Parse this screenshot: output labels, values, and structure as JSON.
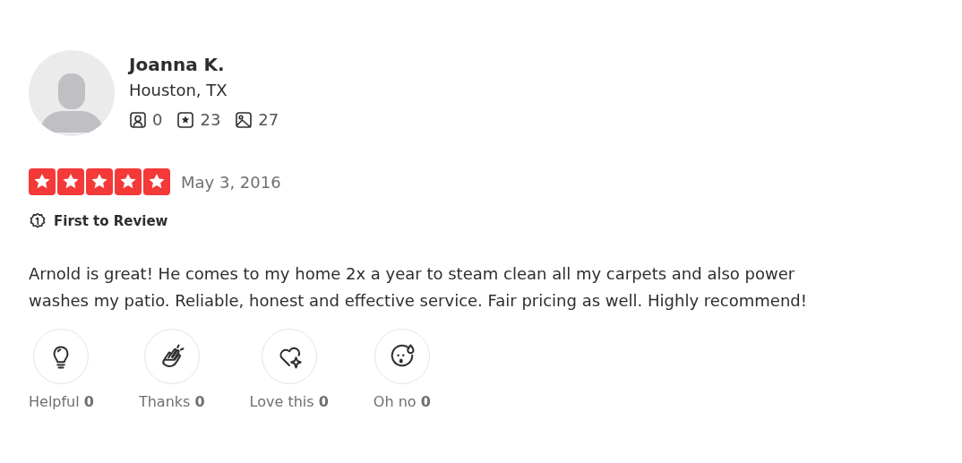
{
  "reviewer": {
    "name": "Joanna K.",
    "location": "Houston, TX",
    "stats": [
      {
        "kind": "friends",
        "count": "0"
      },
      {
        "kind": "reviews",
        "count": "23"
      },
      {
        "kind": "photos",
        "count": "27"
      }
    ]
  },
  "review": {
    "stars": 5,
    "date": "May 3, 2016",
    "badge": "First to Review",
    "text": "Arnold is great! He comes to my home 2x a year to steam clean all my carpets and also power washes my patio. Reliable, honest and effective service. Fair pricing as well. Highly recommend!"
  },
  "reactions": [
    {
      "kind": "helpful",
      "label": "Helpful **0**"
    },
    {
      "kind": "thanks",
      "label": "Thanks **0**"
    },
    {
      "kind": "love",
      "label": "Love this **0**"
    },
    {
      "kind": "oh-no",
      "label": "Oh no **0**"
    }
  ]
}
